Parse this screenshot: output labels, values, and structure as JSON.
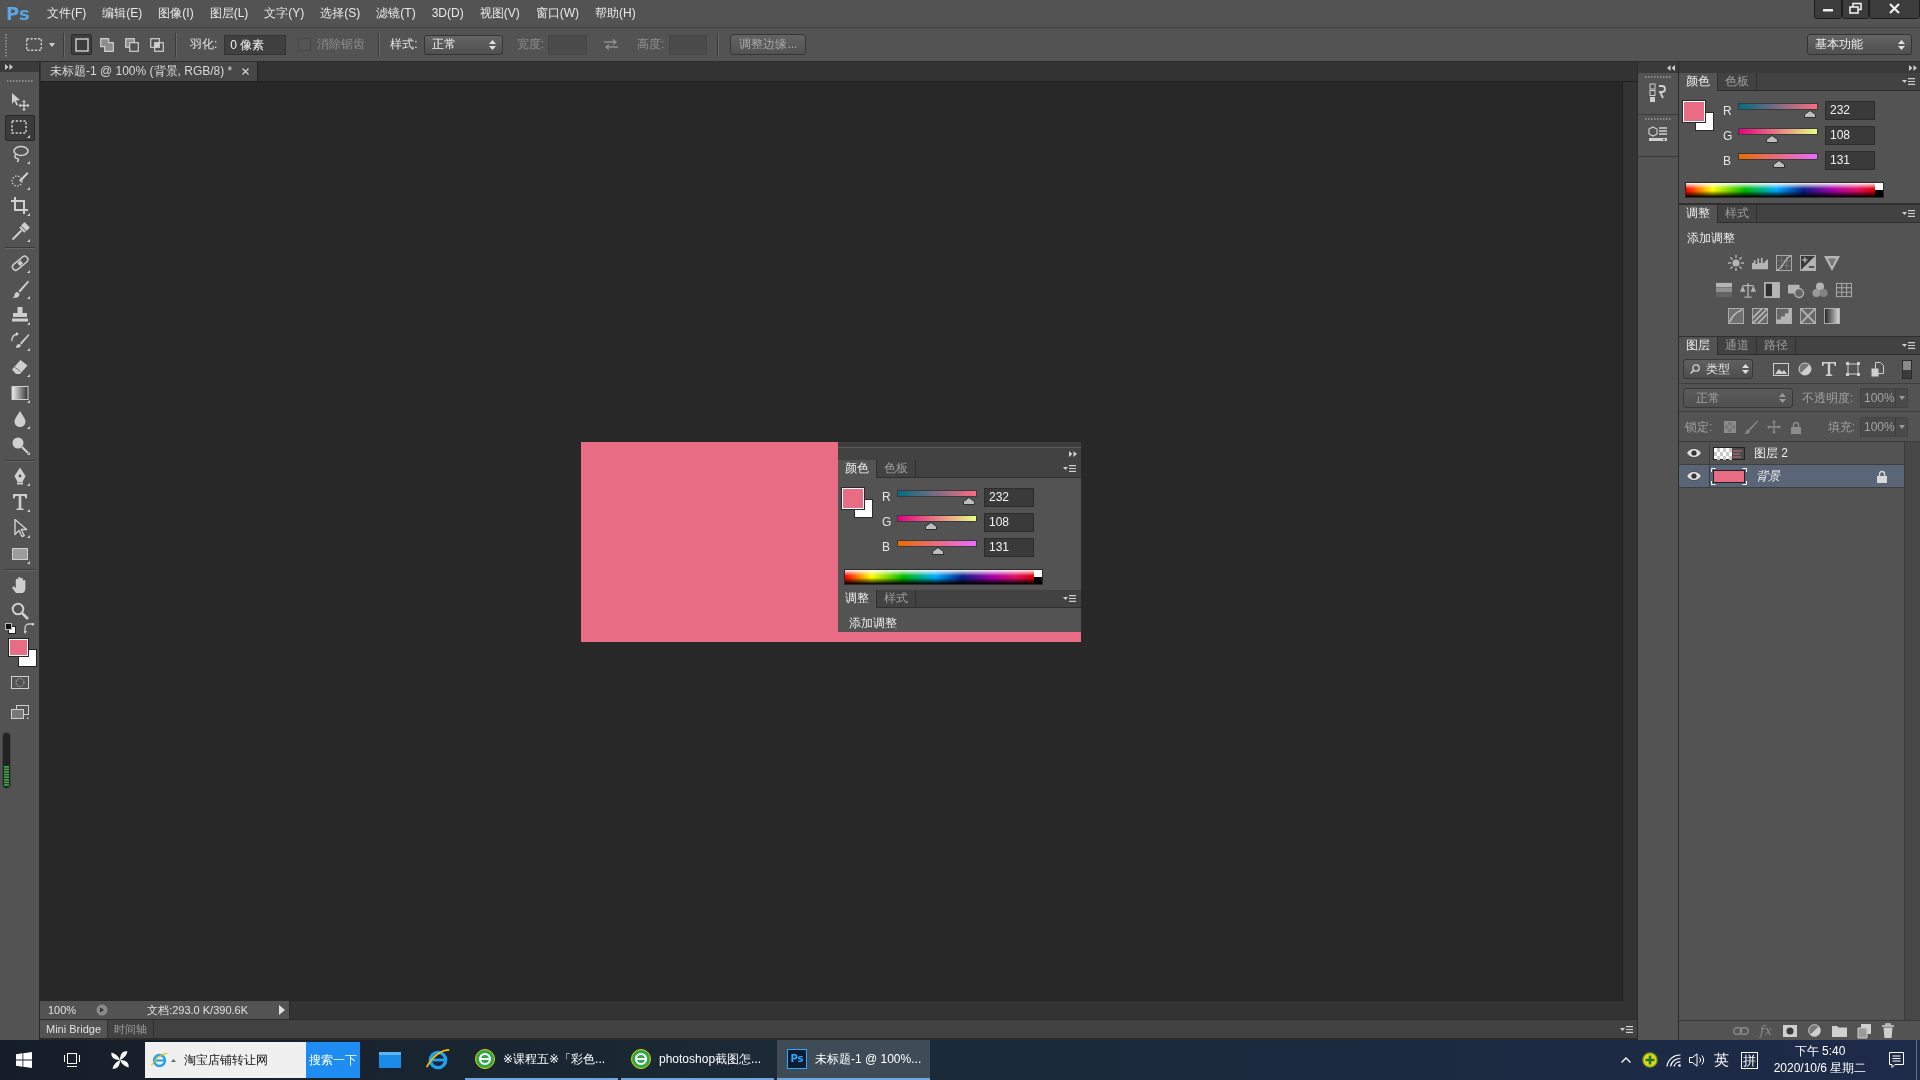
{
  "menu_bar": {
    "logo": "Ps",
    "items": [
      "文件(F)",
      "编辑(E)",
      "图像(I)",
      "图层(L)",
      "文字(Y)",
      "选择(S)",
      "滤镜(T)",
      "3D(D)",
      "视图(V)",
      "窗口(W)",
      "帮助(H)"
    ]
  },
  "options_bar": {
    "selection_modes": [
      {
        "selected": true
      },
      {
        "selected": false
      },
      {
        "selected": false
      },
      {
        "selected": false
      }
    ],
    "feather": {
      "label": "羽化:",
      "value": "0 像素"
    },
    "anti_alias": {
      "label": "消除锯齿",
      "checked": false,
      "disabled": true
    },
    "style": {
      "label": "样式:",
      "value": "正常"
    },
    "width": {
      "label": "宽度:",
      "disabled": true
    },
    "height": {
      "label": "高度:",
      "disabled": true
    },
    "refine_edge": {
      "label": "调整边缘...",
      "disabled": true
    },
    "workspace": "基本功能"
  },
  "document_tabs": [
    {
      "title": "未标题-1 @ 100% (背景, RGB/8) *",
      "selected": true
    }
  ],
  "toolbar": {
    "tool_groups": [
      [
        {
          "kind": "move",
          "selected": false
        },
        {
          "kind": "marquee",
          "selected": true
        },
        {
          "kind": "lasso",
          "selected": false
        },
        {
          "kind": "quickselect",
          "selected": false
        },
        {
          "kind": "crop",
          "selected": false
        },
        {
          "kind": "eyedropper",
          "selected": false
        }
      ],
      [
        {
          "kind": "healing",
          "selected": false
        },
        {
          "kind": "brush",
          "selected": false
        },
        {
          "kind": "stamp",
          "selected": false
        },
        {
          "kind": "historybrush",
          "selected": false
        },
        {
          "kind": "eraser",
          "selected": false
        },
        {
          "kind": "gradient",
          "selected": false
        },
        {
          "kind": "blur",
          "selected": false
        },
        {
          "kind": "dodge",
          "selected": false
        }
      ],
      [
        {
          "kind": "pen",
          "selected": false
        },
        {
          "kind": "type",
          "selected": false
        },
        {
          "kind": "pathselect",
          "selected": false
        },
        {
          "kind": "shape",
          "selected": false
        }
      ],
      [
        {
          "kind": "hand",
          "selected": false
        },
        {
          "kind": "zoom",
          "selected": false
        }
      ]
    ]
  },
  "canvas": {
    "snapshot": {
      "color": {
        "tabs": [
          {
            "label": "颜色",
            "selected": true
          },
          {
            "label": "色板",
            "selected": false
          }
        ],
        "channels": [
          {
            "label": "R",
            "level": 0.9098,
            "reading": "232"
          },
          {
            "label": "G",
            "level": 0.4235,
            "reading": "108"
          },
          {
            "label": "B",
            "level": 0.5137,
            "reading": "131"
          }
        ]
      },
      "adjustments": {
        "tabs": [
          {
            "label": "调整",
            "selected": true
          },
          {
            "label": "样式",
            "selected": false
          }
        ],
        "title": "添加调整"
      }
    }
  },
  "status_bar": {
    "zoom": "100%",
    "document_info": "文档:293.0 K/390.6K"
  },
  "bottom_panel": {
    "tabs": [
      {
        "label": "Mini Bridge",
        "selected": true
      },
      {
        "label": "时间轴",
        "selected": false
      }
    ]
  },
  "panels": {
    "color": {
      "tabs": [
        {
          "label": "颜色",
          "selected": true
        },
        {
          "label": "色板",
          "selected": false
        }
      ],
      "channels": [
        {
          "label": "R",
          "level": 0.9098,
          "reading": "232"
        },
        {
          "label": "G",
          "level": 0.4235,
          "reading": "108"
        },
        {
          "label": "B",
          "level": 0.5137,
          "reading": "131"
        }
      ]
    },
    "adjustments": {
      "tabs": [
        {
          "label": "调整",
          "selected": true
        },
        {
          "label": "样式",
          "selected": false
        }
      ],
      "title": "添加调整"
    },
    "layers": {
      "tabs": [
        {
          "label": "图层",
          "selected": true
        },
        {
          "label": "通道",
          "selected": false
        },
        {
          "label": "路径",
          "selected": false
        }
      ],
      "filter": {
        "value": "类型",
        "on": false
      },
      "blend_mode": {
        "value": "正常",
        "disabled": true
      },
      "opacity": {
        "label": "不透明度:",
        "value": "100%",
        "disabled": true
      },
      "lock": {
        "label": "锁定:",
        "disabled": true
      },
      "fill": {
        "label": "填充:",
        "value": "100%",
        "disabled": true
      },
      "items": [
        {
          "name": "图层 2",
          "kind": "image",
          "visible": true,
          "selected": false,
          "locked": false
        },
        {
          "name": "背景",
          "kind": "background",
          "visible": true,
          "selected": true,
          "locked": true
        }
      ],
      "effects_button": "fx"
    }
  },
  "taskbar": {
    "search": {
      "value": "淘宝店铺转让网",
      "button": "搜索一下"
    },
    "windows": [
      {
        "label": "※课程五※「彩色...",
        "kind": "browser",
        "selected": false
      },
      {
        "label": "photoshop截图怎...",
        "kind": "browser",
        "selected": false
      },
      {
        "label": "未标题-1 @ 100%...",
        "kind": "photoshop",
        "icon_text": "Ps",
        "selected": true
      }
    ],
    "tray": {
      "input_language": "英",
      "input_mode": "拼",
      "time": "下午 5:40",
      "date": "2020/10/6 星期二"
    }
  }
}
